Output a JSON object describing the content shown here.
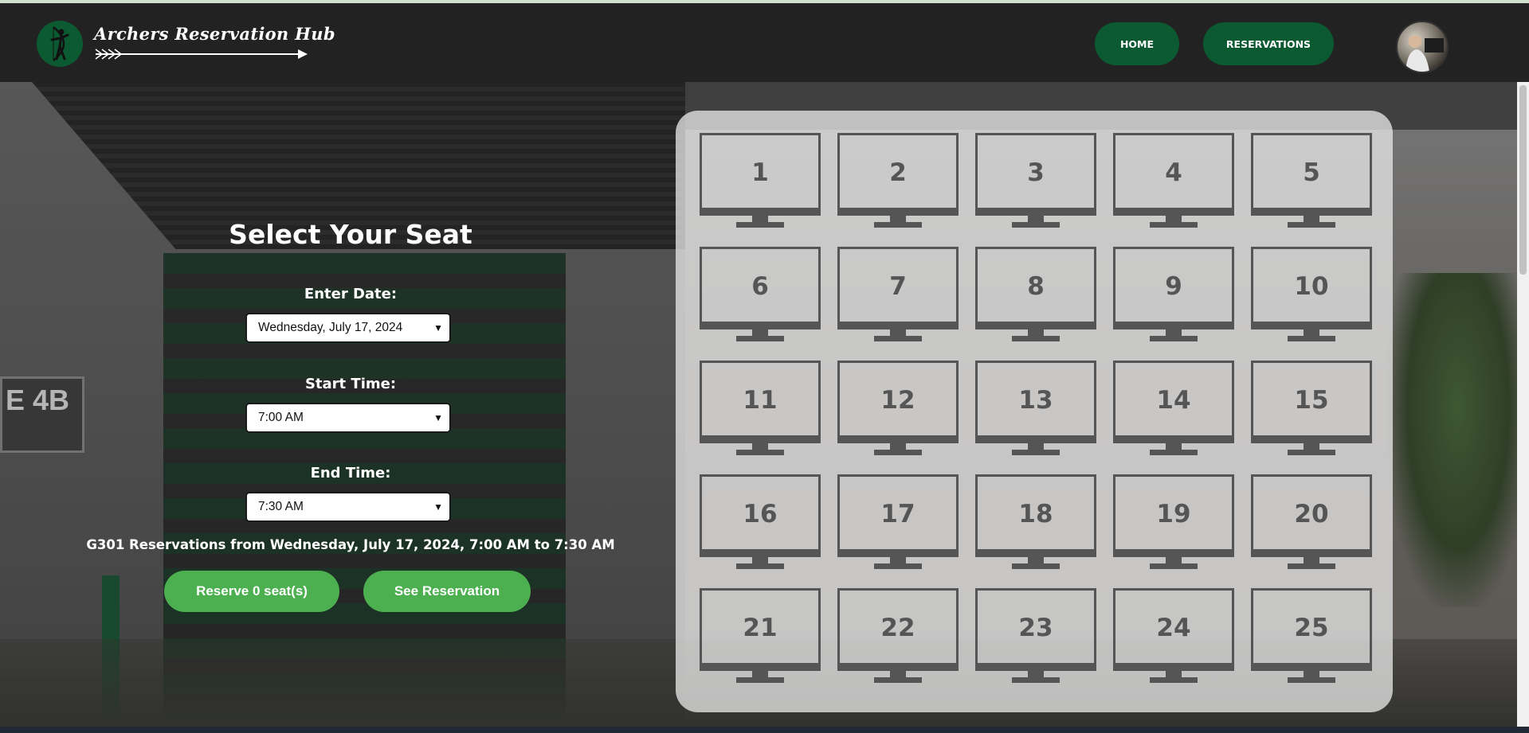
{
  "brand": {
    "name": "Archers Reservation Hub",
    "logo_icon": "archer-icon",
    "colors": {
      "primary": "#0c5a32",
      "accent": "#4caf50",
      "navbar": "#222222"
    }
  },
  "nav": {
    "home_label": "HOME",
    "reservations_label": "RESERVATIONS"
  },
  "form": {
    "title": "Select Your Seat",
    "date_label": "Enter Date:",
    "date_value": "Wednesday, July 17, 2024",
    "start_label": "Start Time:",
    "start_value": "7:00 AM",
    "end_label": "End Time:",
    "end_value": "7:30 AM",
    "summary": "G301 Reservations from Wednesday, July 17, 2024, 7:00 AM to 7:30 AM",
    "reserve_label": "Reserve 0 seat(s)",
    "see_label": "See Reservation"
  },
  "seats": [
    "1",
    "2",
    "3",
    "4",
    "5",
    "6",
    "7",
    "8",
    "9",
    "10",
    "11",
    "12",
    "13",
    "14",
    "15",
    "16",
    "17",
    "18",
    "19",
    "20",
    "21",
    "22",
    "23",
    "24",
    "25"
  ],
  "background": {
    "sign_text": "E 4B"
  }
}
